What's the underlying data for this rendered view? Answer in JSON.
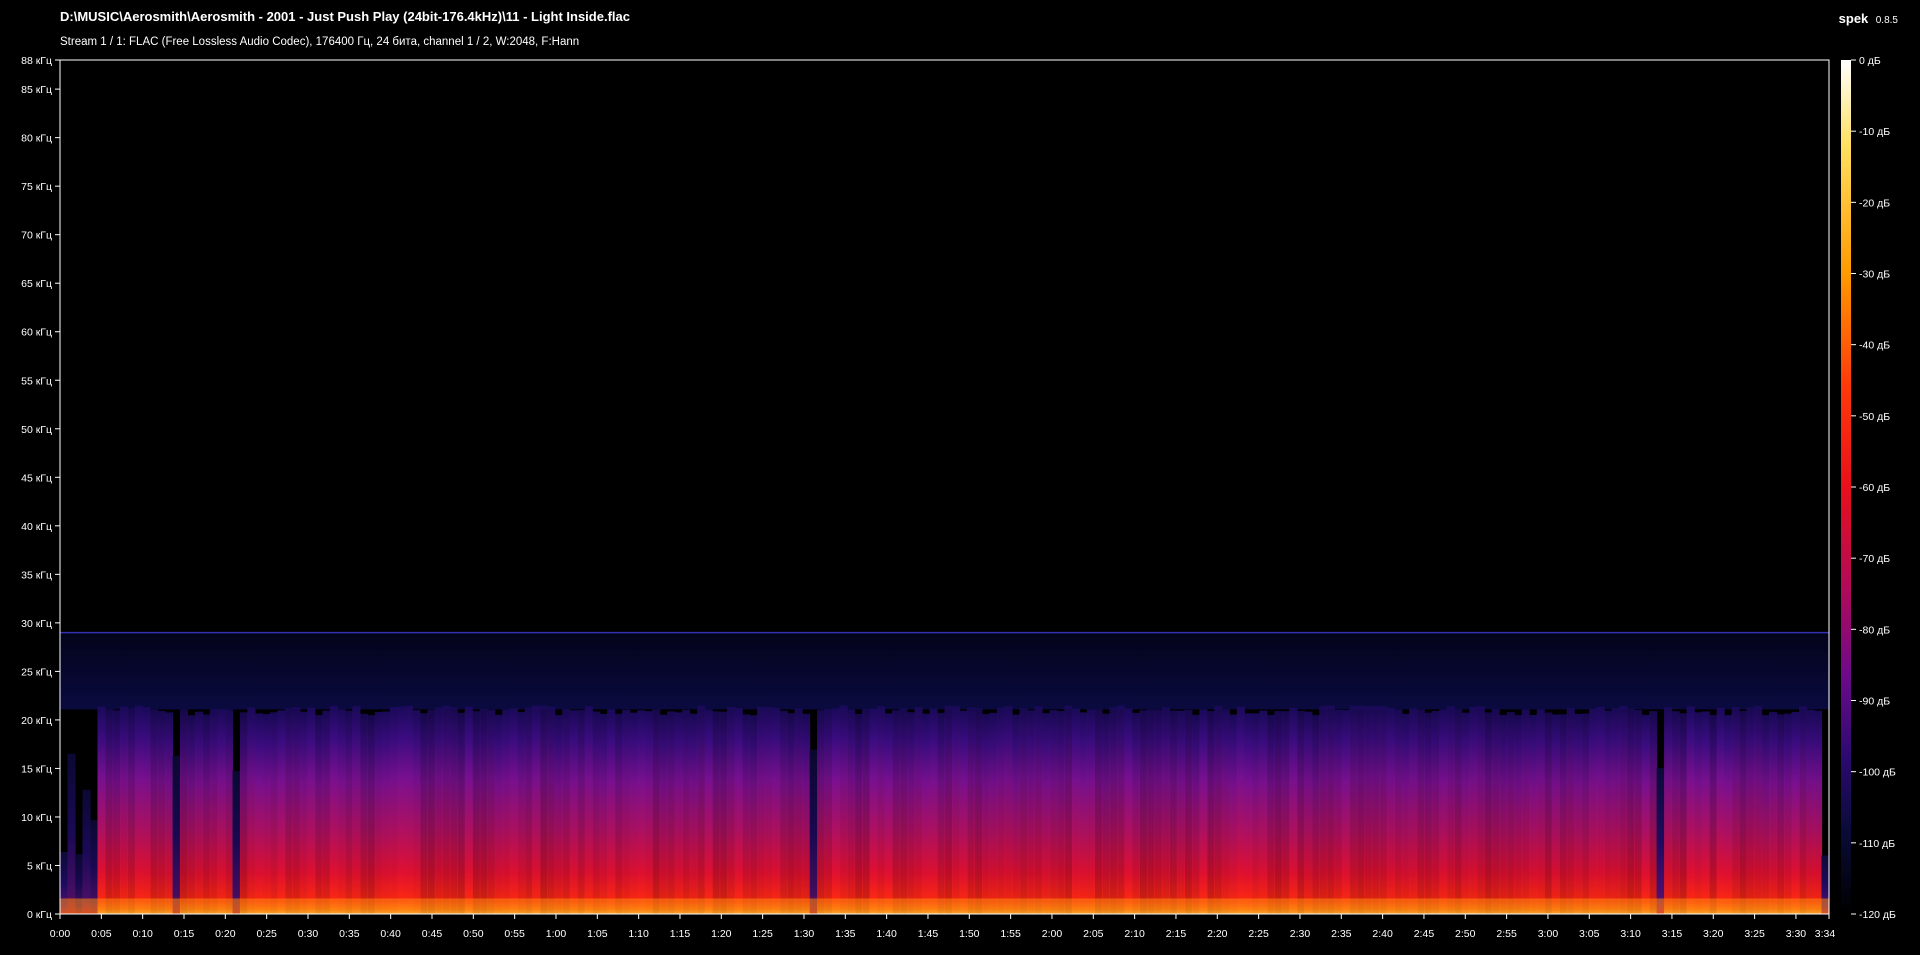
{
  "header": {
    "file_path": "D:\\MUSIC\\Aerosmith\\Aerosmith - 2001 - Just Push Play (24bit-176.4kHz)\\11 - Light Inside.flac",
    "stream_info": "Stream 1 / 1: FLAC (Free Lossless Audio Codec), 176400 Гц, 24 бита, channel 1 / 2, W:2048, F:Hann"
  },
  "app": {
    "name": "spek",
    "version": "0.8.5"
  },
  "colors": {
    "background": "#000000",
    "text": "#ffffff",
    "axis": "#ffffff",
    "palette": [
      "#000000",
      "#0b0b3a",
      "#2a0a6e",
      "#6d0a8a",
      "#b00a5a",
      "#e8101a",
      "#ff3a0a",
      "#ff9a00",
      "#ffe060",
      "#ffffff"
    ]
  },
  "chart_data": {
    "type": "heatmap",
    "frequency_axis": {
      "unit": "кГц",
      "ylim": [
        0,
        88
      ],
      "top_label": "88 кГц",
      "ticks": [
        "0 кГц",
        "5 кГц",
        "10 кГц",
        "15 кГц",
        "20 кГц",
        "25 кГц",
        "30 кГц",
        "35 кГц",
        "40 кГц",
        "45 кГц",
        "50 кГц",
        "55 кГц",
        "60 кГц",
        "65 кГц",
        "70 кГц",
        "75 кГц",
        "80 кГц",
        "85 кГц"
      ],
      "tick_values": [
        0,
        5,
        10,
        15,
        20,
        25,
        30,
        35,
        40,
        45,
        50,
        55,
        60,
        65,
        70,
        75,
        80,
        85
      ]
    },
    "time_axis": {
      "xlim_seconds": [
        0,
        214
      ],
      "ticks": [
        "0:00",
        "0:05",
        "0:10",
        "0:15",
        "0:20",
        "0:25",
        "0:30",
        "0:35",
        "0:40",
        "0:45",
        "0:50",
        "0:55",
        "1:00",
        "1:05",
        "1:10",
        "1:15",
        "1:20",
        "1:25",
        "1:30",
        "1:35",
        "1:40",
        "1:45",
        "1:50",
        "1:55",
        "2:00",
        "2:05",
        "2:10",
        "2:15",
        "2:20",
        "2:25",
        "2:30",
        "2:35",
        "2:40",
        "2:45",
        "2:50",
        "2:55",
        "3:00",
        "3:05",
        "3:10",
        "3:15",
        "3:20",
        "3:25",
        "3:30"
      ],
      "end_label": "3:34",
      "tick_step_seconds": 5
    },
    "db_scale": {
      "range": [
        -120,
        0
      ],
      "ticks": [
        "0 дБ",
        "-10 дБ",
        "-20 дБ",
        "-30 дБ",
        "-40 дБ",
        "-50 дБ",
        "-60 дБ",
        "-70 дБ",
        "-80 дБ",
        "-90 дБ",
        "-100 дБ",
        "-110 дБ",
        "-120 дБ"
      ],
      "tick_values": [
        0,
        -10,
        -20,
        -30,
        -40,
        -50,
        -60,
        -70,
        -80,
        -90,
        -100,
        -110,
        -120
      ]
    },
    "features": {
      "noise_line_khz": 29,
      "content_cutoff_khz": 21.5
    }
  }
}
